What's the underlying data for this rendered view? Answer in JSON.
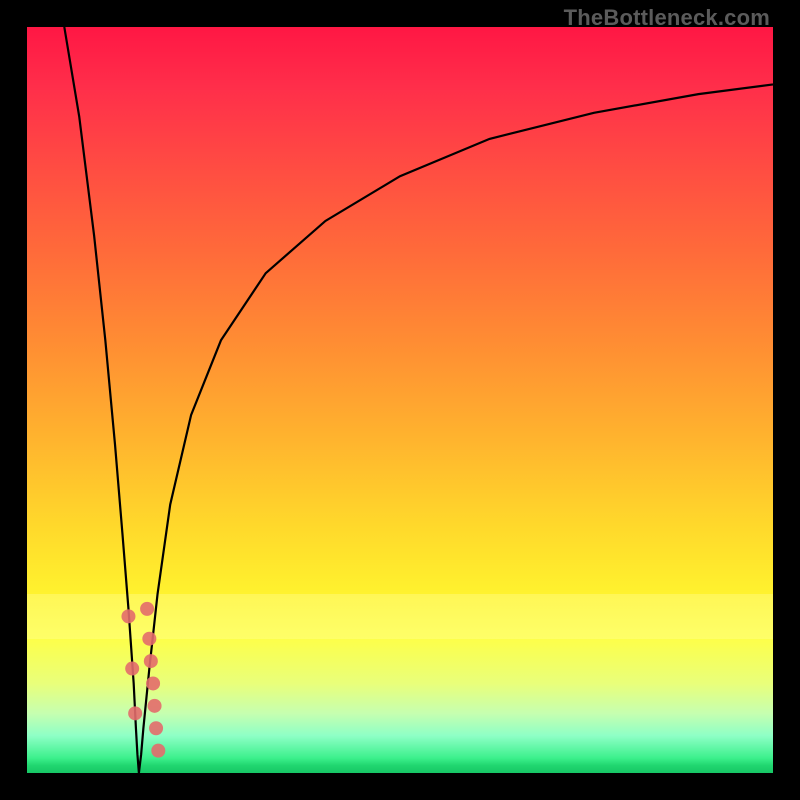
{
  "source_label": "TheBottleneck.com",
  "chart_data": {
    "type": "line",
    "title": "",
    "xlabel": "",
    "ylabel": "",
    "xlim": [
      0,
      100
    ],
    "ylim": [
      0,
      100
    ],
    "grid": false,
    "curve": [
      {
        "x": 5,
        "y": 100
      },
      {
        "x": 7,
        "y": 88
      },
      {
        "x": 9,
        "y": 72
      },
      {
        "x": 10.5,
        "y": 58
      },
      {
        "x": 11.8,
        "y": 44
      },
      {
        "x": 12.8,
        "y": 32
      },
      {
        "x": 13.6,
        "y": 22
      },
      {
        "x": 14.3,
        "y": 12
      },
      {
        "x": 14.6,
        "y": 6
      },
      {
        "x": 14.8,
        "y": 2.5
      },
      {
        "x": 15,
        "y": 0
      },
      {
        "x": 15.3,
        "y": 2.5
      },
      {
        "x": 15.6,
        "y": 6
      },
      {
        "x": 16.4,
        "y": 14
      },
      {
        "x": 17.5,
        "y": 24
      },
      {
        "x": 19.2,
        "y": 36
      },
      {
        "x": 22,
        "y": 48
      },
      {
        "x": 26,
        "y": 58
      },
      {
        "x": 32,
        "y": 67
      },
      {
        "x": 40,
        "y": 74
      },
      {
        "x": 50,
        "y": 80
      },
      {
        "x": 62,
        "y": 85
      },
      {
        "x": 76,
        "y": 88.5
      },
      {
        "x": 90,
        "y": 91
      },
      {
        "x": 100,
        "y": 92.3
      }
    ],
    "bottleneck_markers_left": [
      {
        "x": 13.6,
        "y": 21
      },
      {
        "x": 14.1,
        "y": 14
      },
      {
        "x": 14.5,
        "y": 8
      }
    ],
    "bottleneck_markers_right": [
      {
        "x": 16.1,
        "y": 22
      },
      {
        "x": 16.4,
        "y": 18
      },
      {
        "x": 16.6,
        "y": 15
      },
      {
        "x": 16.9,
        "y": 12
      },
      {
        "x": 17.1,
        "y": 9
      },
      {
        "x": 17.3,
        "y": 6
      },
      {
        "x": 17.6,
        "y": 3
      }
    ],
    "minimum_point": {
      "x": 15,
      "y": 0
    },
    "colors": {
      "top": "#ff1744",
      "mid": "#ffd92b",
      "bottom": "#17c766",
      "curve": "#000000",
      "marker": "#e36b6b"
    }
  }
}
